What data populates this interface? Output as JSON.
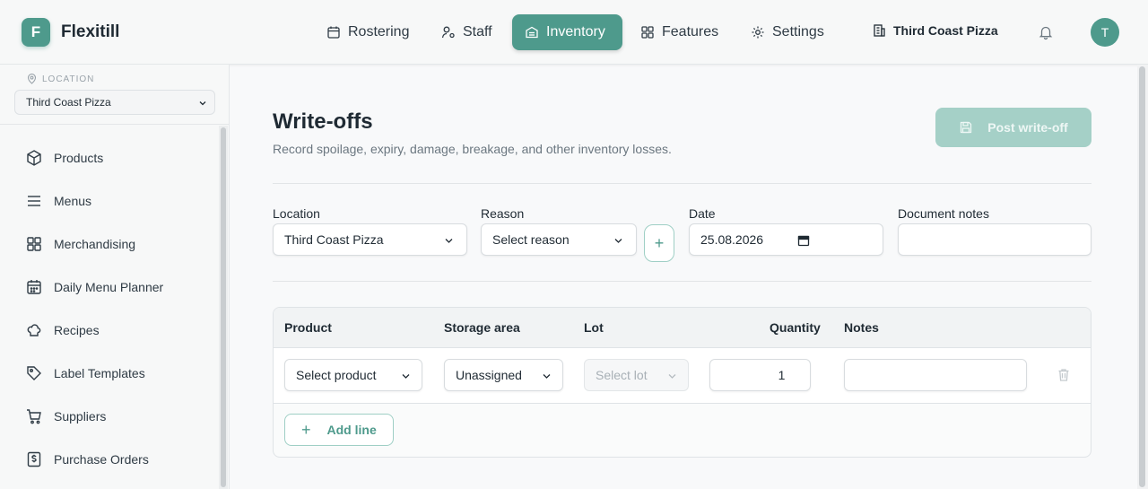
{
  "app": {
    "logo_letter": "F",
    "name": "Flexitill",
    "accent": "#4e9a8c"
  },
  "nav": {
    "items": [
      {
        "label": "Rostering",
        "icon": "calendar-icon"
      },
      {
        "label": "Staff",
        "icon": "user-icon"
      },
      {
        "label": "Inventory",
        "icon": "inventory-icon",
        "active": true
      },
      {
        "label": "Features",
        "icon": "grid-icon"
      },
      {
        "label": "Settings",
        "icon": "gear-icon"
      }
    ],
    "location": "Third Coast Pizza",
    "avatar_initial": "T"
  },
  "sidebar": {
    "location_label": "LOCATION",
    "location_value": "Third Coast Pizza",
    "items": [
      {
        "label": "Products",
        "icon": "box-icon"
      },
      {
        "label": "Menus",
        "icon": "menu-lines-icon"
      },
      {
        "label": "Merchandising",
        "icon": "grid-icon"
      },
      {
        "label": "Daily Menu Planner",
        "icon": "calendar-icon"
      },
      {
        "label": "Recipes",
        "icon": "chef-hat-icon"
      },
      {
        "label": "Label Templates",
        "icon": "tag-icon"
      },
      {
        "label": "Suppliers",
        "icon": "cart-icon"
      },
      {
        "label": "Purchase Orders",
        "icon": "receipt-icon"
      }
    ]
  },
  "page": {
    "title": "Write-offs",
    "subtitle": "Record spoilage, expiry, damage, breakage, and other inventory losses.",
    "post_button": "Post write-off"
  },
  "form": {
    "location_label": "Location",
    "location_value": "Third Coast Pizza",
    "reason_label": "Reason",
    "reason_value": "Select reason",
    "add_reason": "+",
    "date_label": "Date",
    "date_value": "25.08.2026",
    "notes_label": "Document notes",
    "notes_value": ""
  },
  "table": {
    "headers": [
      "Product",
      "Storage area",
      "Lot",
      "Quantity",
      "Notes"
    ],
    "rows": [
      {
        "product": "Select product",
        "storage": "Unassigned",
        "lot": "Select lot",
        "quantity": "1",
        "notes": ""
      }
    ],
    "add_line": "Add line"
  }
}
